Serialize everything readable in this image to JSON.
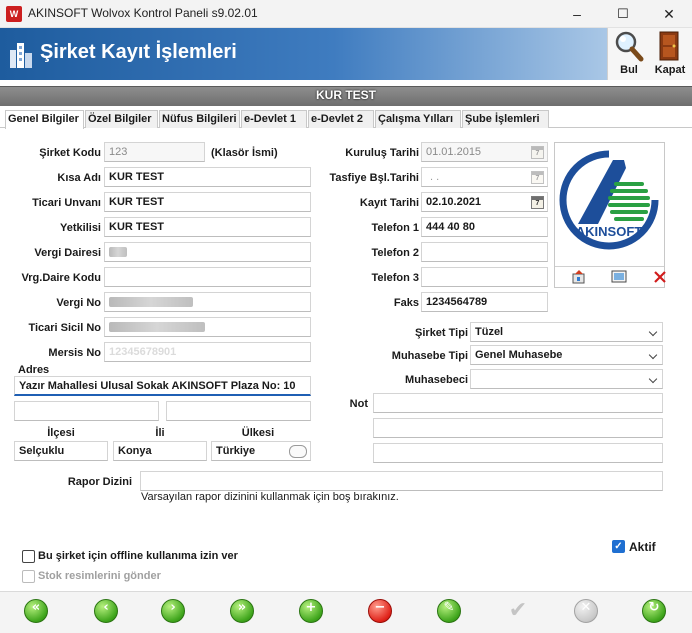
{
  "window": {
    "title": "AKINSOFT Wolvox Kontrol Paneli s9.02.01",
    "minimize": "–",
    "maximize": "☐",
    "close": "✕"
  },
  "header": {
    "title": "Şirket Kayıt İşlemleri",
    "find_label": "Bul",
    "close_label": "Kapat"
  },
  "company_bar": "KUR TEST",
  "tabs": [
    {
      "label": "Genel Bilgiler",
      "active": true
    },
    {
      "label": "Özel Bilgiler"
    },
    {
      "label": "Nüfus Bilgileri"
    },
    {
      "label": "e-Devlet 1"
    },
    {
      "label": "e-Devlet 2"
    },
    {
      "label": "Çalışma Yılları"
    },
    {
      "label": "Şube İşlemleri"
    }
  ],
  "form": {
    "sirket_kodu": {
      "label": "Şirket Kodu",
      "value": "123",
      "suffix": "(Klasör İsmi)"
    },
    "kisa_adi": {
      "label": "Kısa Adı",
      "value": "KUR TEST"
    },
    "ticari_unvani": {
      "label": "Ticari Unvanı",
      "value": "KUR TEST"
    },
    "yetkilisi": {
      "label": "Yetkilisi",
      "value": "KUR TEST"
    },
    "vergi_dairesi": {
      "label": "Vergi Dairesi"
    },
    "vrg_daire_kodu": {
      "label": "Vrg.Daire Kodu"
    },
    "vergi_no": {
      "label": "Vergi No"
    },
    "ticari_sicil_no": {
      "label": "Ticari Sicil No"
    },
    "mersis_no": {
      "label": "Mersis No",
      "value": "12345678901"
    },
    "adres": {
      "label": "Adres",
      "line1": "Yazır Mahallesi Ulusal Sokak AKINSOFT Plaza No: 10"
    },
    "ilcesi": {
      "label": "İlçesi",
      "value": "Selçuklu"
    },
    "ili": {
      "label": "İli",
      "value": "Konya"
    },
    "ulkesi": {
      "label": "Ülkesi",
      "value": "Türkiye"
    },
    "kurulus_tarihi": {
      "label": "Kuruluş Tarihi",
      "value": "01.01.2015"
    },
    "tasfiye_tarihi": {
      "label": "Tasfiye Bşl.Tarihi",
      "value": ". ."
    },
    "kayit_tarihi": {
      "label": "Kayıt Tarihi",
      "value": "02.10.2021"
    },
    "telefon1": {
      "label": "Telefon 1",
      "value": "444 40 80"
    },
    "telefon2": {
      "label": "Telefon 2"
    },
    "telefon3": {
      "label": "Telefon 3"
    },
    "faks": {
      "label": "Faks",
      "value": "1234564789"
    },
    "sirket_tipi": {
      "label": "Şirket Tipi",
      "value": "Tüzel"
    },
    "muhasebe_tipi": {
      "label": "Muhasebe Tipi",
      "value": "Genel Muhasebe"
    },
    "muhasebeci": {
      "label": "Muhasebeci",
      "value": ""
    },
    "not": {
      "label": "Not"
    },
    "rapor_dizini": {
      "label": "Rapor Dizini",
      "hint": "Varsayılan rapor dizinini kullanmak için boş bırakınız."
    }
  },
  "logo": {
    "text": "AKINSOFT"
  },
  "options": {
    "offline": {
      "label": "Bu şirket için offline kullanıma izin ver",
      "checked": false
    },
    "stok_resim": {
      "label": "Stok resimlerini gönder",
      "checked": false,
      "disabled": true
    },
    "aktif": {
      "label": "Aktif",
      "checked": true
    }
  },
  "colors": {
    "banner": "#1e5c9e",
    "accent": "#1f6fd1",
    "logo_blue": "#1d4e9a",
    "logo_green": "#2aa043"
  }
}
